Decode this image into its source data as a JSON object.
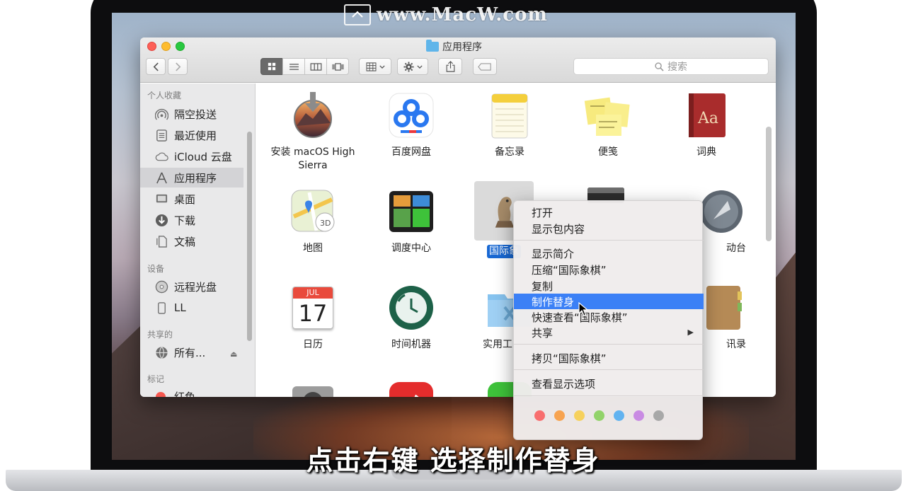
{
  "watermark": {
    "text": "www.MacW.com"
  },
  "finder": {
    "title": "应用程序",
    "search_placeholder": "搜索",
    "sidebar": {
      "headers": [
        "个人收藏",
        "设备",
        "共享的",
        "标记"
      ],
      "favorites": [
        {
          "label": "隔空投送",
          "icon": "airdrop-icon"
        },
        {
          "label": "最近使用",
          "icon": "recents-icon"
        },
        {
          "label": "iCloud 云盘",
          "icon": "cloud-icon"
        },
        {
          "label": "应用程序",
          "icon": "applications-icon",
          "selected": true
        },
        {
          "label": "桌面",
          "icon": "desktop-icon"
        },
        {
          "label": "下载",
          "icon": "download-icon"
        },
        {
          "label": "文稿",
          "icon": "documents-icon"
        }
      ],
      "devices": [
        {
          "label": "远程光盘",
          "icon": "disc-icon"
        },
        {
          "label": "LL",
          "icon": "drive-icon"
        }
      ],
      "shared": [
        {
          "label": "所有...",
          "icon": "network-icon"
        }
      ],
      "tags": [
        {
          "label": "红色",
          "color": "#f5574f"
        }
      ]
    },
    "apps": [
      {
        "label": "安装 macOS High Sierra",
        "icon": "macos-installer-icon"
      },
      {
        "label": "百度网盘",
        "icon": "baidu-netdisk-icon"
      },
      {
        "label": "备忘录",
        "icon": "notes-icon"
      },
      {
        "label": "便笺",
        "icon": "stickies-icon"
      },
      {
        "label": "词典",
        "icon": "dictionary-icon"
      },
      {
        "label": "地图",
        "icon": "maps-icon"
      },
      {
        "label": "调度中心",
        "icon": "mission-control-icon"
      },
      {
        "label": "国际象",
        "icon": "chess-icon",
        "selected": true
      },
      {
        "label": "",
        "icon": "calculator-icon"
      },
      {
        "label": "动台",
        "icon": "launchpad-icon"
      },
      {
        "label": "日历",
        "icon": "calendar-icon",
        "month": "JUL",
        "day": "17"
      },
      {
        "label": "时间机器",
        "icon": "time-machine-icon"
      },
      {
        "label": "实用工",
        "icon": "utilities-folder-icon"
      },
      {
        "label": "",
        "icon": "ibooks-icon"
      },
      {
        "label": "讯录",
        "icon": "contacts-icon"
      }
    ]
  },
  "context_menu": {
    "items": [
      {
        "label": "打开"
      },
      {
        "label": "显示包内容"
      },
      {
        "label": "显示简介"
      },
      {
        "label": "压缩“国际象棋”"
      },
      {
        "label": "复制"
      },
      {
        "label": "制作替身",
        "highlighted": true
      },
      {
        "label": "快速查看“国际象棋”"
      },
      {
        "label": "共享",
        "submenu": true
      },
      {
        "label": "拷贝“国际象棋”"
      },
      {
        "label": "查看显示选项"
      }
    ],
    "tag_colors": [
      "#f86e6e",
      "#f7a34f",
      "#f6d15c",
      "#92d36a",
      "#62b3f0",
      "#c98be3",
      "#a8a8a8"
    ]
  },
  "subtitle": "点击右键 选择制作替身"
}
